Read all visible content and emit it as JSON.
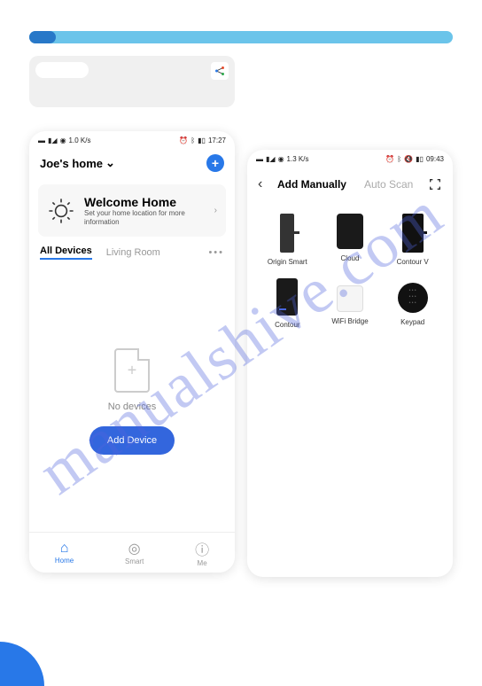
{
  "watermark": "manualshive.com",
  "phone_left": {
    "status_time": "17:27",
    "status_signal": "1.0 K/s",
    "home_name": "Joe's home",
    "welcome_title": "Welcome Home",
    "welcome_subtitle": "Set your home location for more information",
    "tabs": {
      "all": "All Devices",
      "living": "Living Room"
    },
    "empty": "No devices",
    "add_device": "Add Device",
    "nav": {
      "home": "Home",
      "smart": "Smart",
      "me": "Me"
    }
  },
  "phone_right": {
    "status_time": "09:43",
    "status_signal": "1.3 K/s",
    "tabs": {
      "manual": "Add Manually",
      "auto": "Auto Scan"
    },
    "devices": {
      "origin": "Origin Smart",
      "cloud": "Cloud",
      "contourv": "Contour V",
      "contour": "Contour",
      "bridge": "WiFi Bridge",
      "keypad": "Keypad"
    }
  }
}
